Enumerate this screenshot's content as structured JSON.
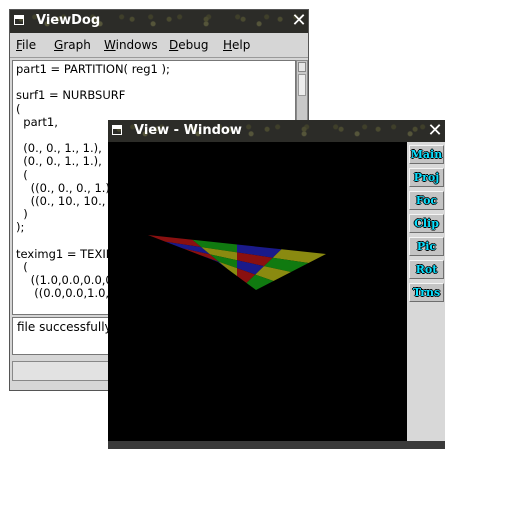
{
  "viewdog": {
    "title": "ViewDog",
    "menu": [
      {
        "label": "File",
        "underline": "F",
        "rest": "ile"
      },
      {
        "label": "Graph",
        "underline": "G",
        "rest": "raph"
      },
      {
        "label": "Windows",
        "underline": "W",
        "rest": "indows"
      },
      {
        "label": "Debug",
        "underline": "D",
        "rest": "ebug"
      },
      {
        "label": "Help",
        "underline": "H",
        "rest": "elp"
      }
    ],
    "code": "part1 = PARTITION( reg1 );\n\nsurf1 = NURBSURF\n(\n  part1,\n\n  (0., 0., 1., 1.),\n  (0., 0., 1., 1.),\n  (\n    ((0., 0., 0., 1.),\n    ((0., 10., 10.,\n  )\n);\n\nteximg1 = TEXIM\n  (\n    ((1.0,0.0,0.0,0.0\n     ((0.0,0.0,1.0,0",
    "status": "file successfully"
  },
  "view_window": {
    "title": "View - Window",
    "buttons": [
      "Main",
      "Proj",
      "Foc",
      "Clip",
      "Pic",
      "Rot",
      "Trns"
    ]
  },
  "surface_colors": [
    "#8a1010",
    "#107a10",
    "#1a1a8a",
    "#8a8a10"
  ]
}
